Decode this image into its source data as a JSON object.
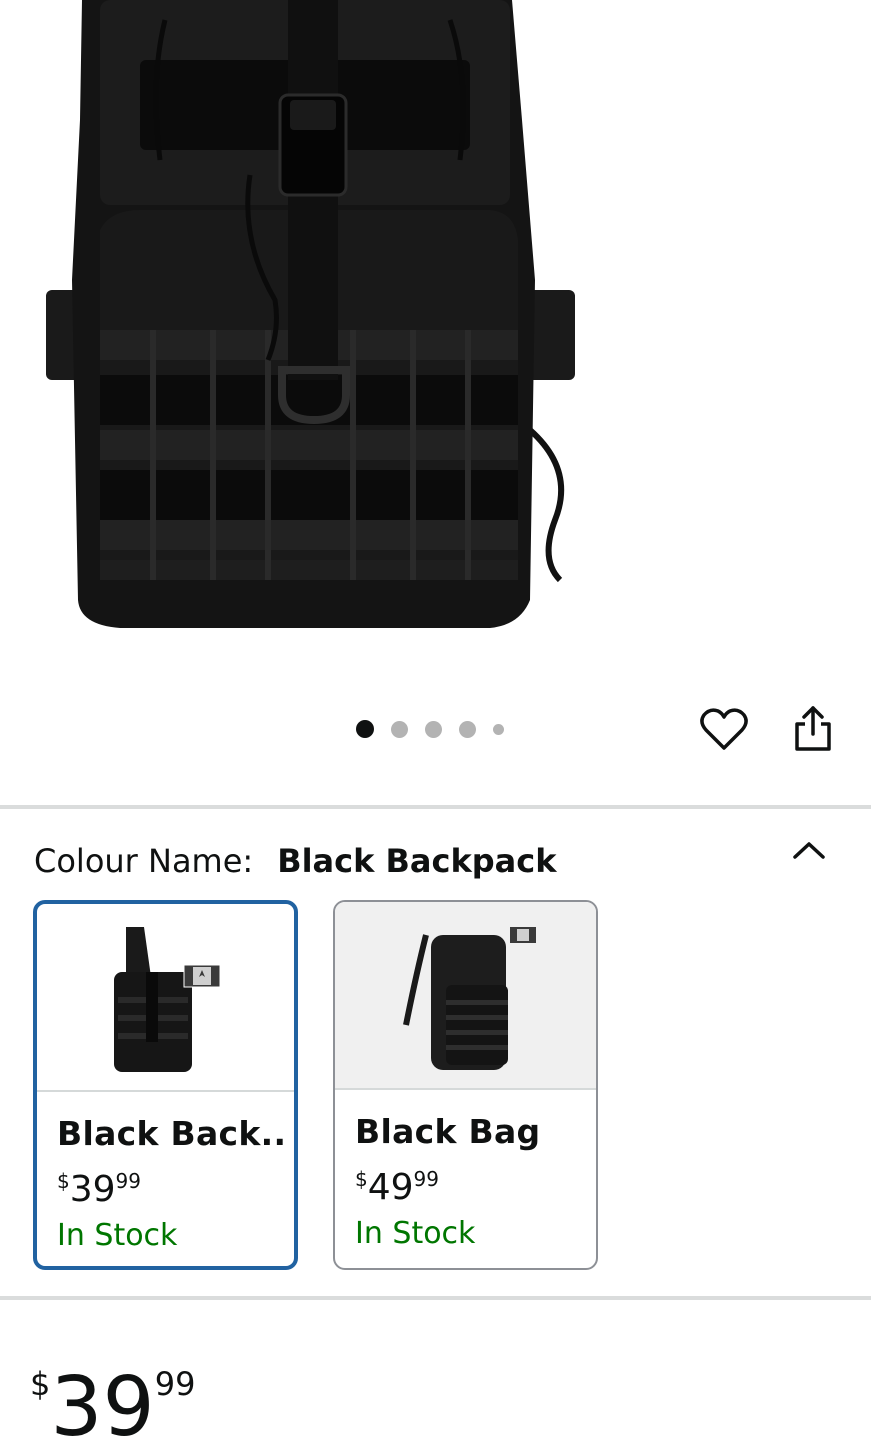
{
  "product_gallery": {
    "image_alt": "Black tactical sling backpack",
    "image_count": 5,
    "active_index": 0
  },
  "actions": {
    "wishlist_icon": "heart-outline-icon",
    "share_icon": "share-icon"
  },
  "variation": {
    "label": "Colour Name:",
    "selected_value": "Black Backpack",
    "toggle_icon": "chevron-up-icon",
    "options": [
      {
        "name": "Black Back...",
        "currency": "$",
        "price_whole": "39",
        "price_fraction": "99",
        "availability": "In Stock",
        "selected": true
      },
      {
        "name": "Black Bag",
        "currency": "$",
        "price_whole": "49",
        "price_fraction": "99",
        "availability": "In Stock",
        "selected": false
      }
    ]
  },
  "price": {
    "currency": "$",
    "whole": "39",
    "fraction": "99"
  },
  "colors": {
    "selected_border": "#2162a1",
    "in_stock": "#007600",
    "text": "#0f1111",
    "divider": "#dadcdc"
  }
}
